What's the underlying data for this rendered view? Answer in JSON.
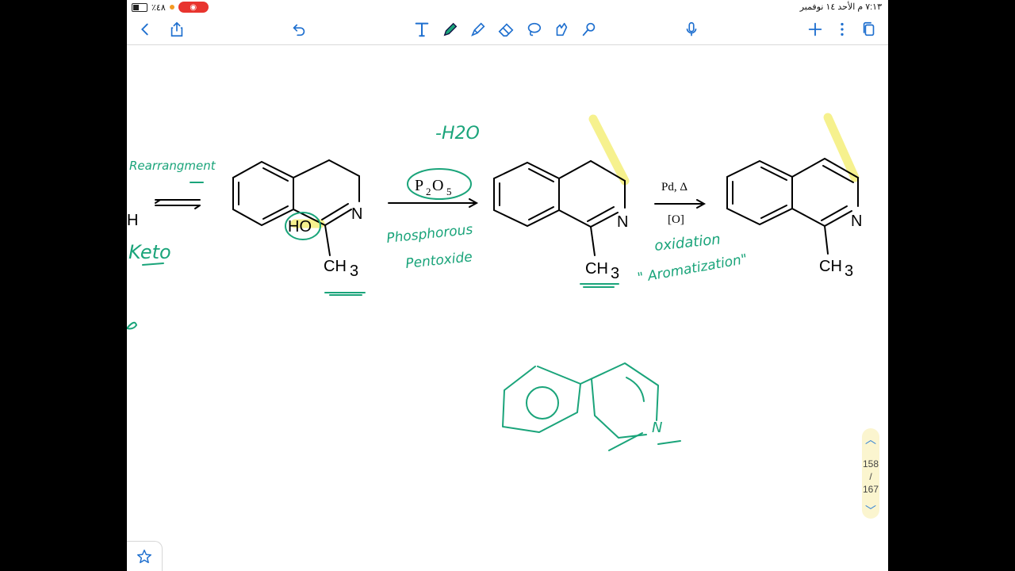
{
  "status_bar": {
    "battery_percent": "٪٤٨",
    "datetime": "٧:١٣ م   الأحد ١٤ نوفمبر",
    "recording_icon": "record-icon"
  },
  "toolbar": {
    "left": [
      "back-icon",
      "share-icon",
      "undo-icon"
    ],
    "tools": [
      "text-tool-icon",
      "pen-tool-icon",
      "highlighter-tool-icon",
      "eraser-tool-icon",
      "lasso-tool-icon",
      "shapes-tool-icon",
      "laser-pointer-icon"
    ],
    "right": [
      "microphone-icon",
      "add-page-icon",
      "more-icon",
      "pages-icon"
    ],
    "accent_color": "#1e6fcf"
  },
  "note": {
    "ink_color": "#1aa47a",
    "highlight_color": "#f4ee7a",
    "left_edge_fragment": "H",
    "annotations": {
      "rearrangement": "Rearrangment",
      "keto": "Keto",
      "minus_h2o": "-H2O",
      "phosphorous": "Phosphorous",
      "pentoxide": "Pentoxide",
      "oxidation": "oxidation",
      "aromatization": "\" Aromatization\"",
      "sketch_n": "N"
    },
    "structure_labels": {
      "ho": "HO",
      "n": "N",
      "ch3": "CH",
      "ch3_sub": "3"
    },
    "reagents": {
      "p2o5_p": "P",
      "p2o5_sub2": "2",
      "p2o5_o": "O",
      "p2o5_sub5": "5",
      "pd": "Pd, Δ",
      "o": "[O]"
    }
  },
  "pager": {
    "current_page": "158",
    "separator": "/",
    "total_pages": "167"
  },
  "favorite_button_icon": "star-icon"
}
